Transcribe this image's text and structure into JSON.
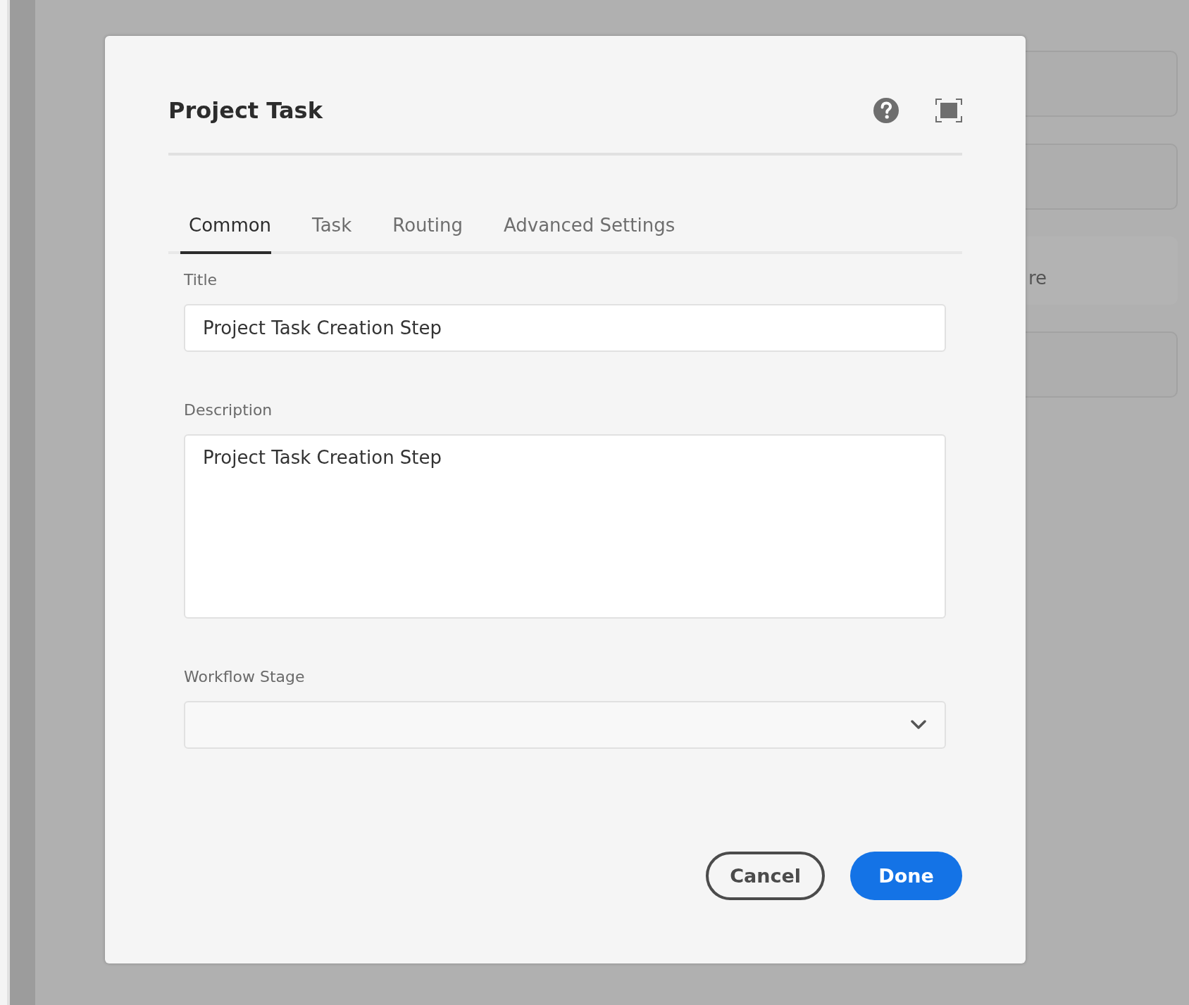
{
  "background": {
    "card_text": "re"
  },
  "dialog": {
    "title": "Project Task",
    "tabs": [
      {
        "label": "Common",
        "selected": true
      },
      {
        "label": "Task",
        "selected": false
      },
      {
        "label": "Routing",
        "selected": false
      },
      {
        "label": "Advanced Settings",
        "selected": false
      }
    ],
    "fields": [
      {
        "kind": "input",
        "label": "Title",
        "value": "Project Task Creation Step"
      },
      {
        "kind": "textarea",
        "label": "Description",
        "value": "Project Task Creation Step"
      },
      {
        "kind": "select",
        "label": "Workflow Stage"
      }
    ],
    "buttons": [
      {
        "kind": "secondary",
        "label": "Cancel"
      },
      {
        "kind": "primary",
        "label": "Done"
      }
    ]
  }
}
